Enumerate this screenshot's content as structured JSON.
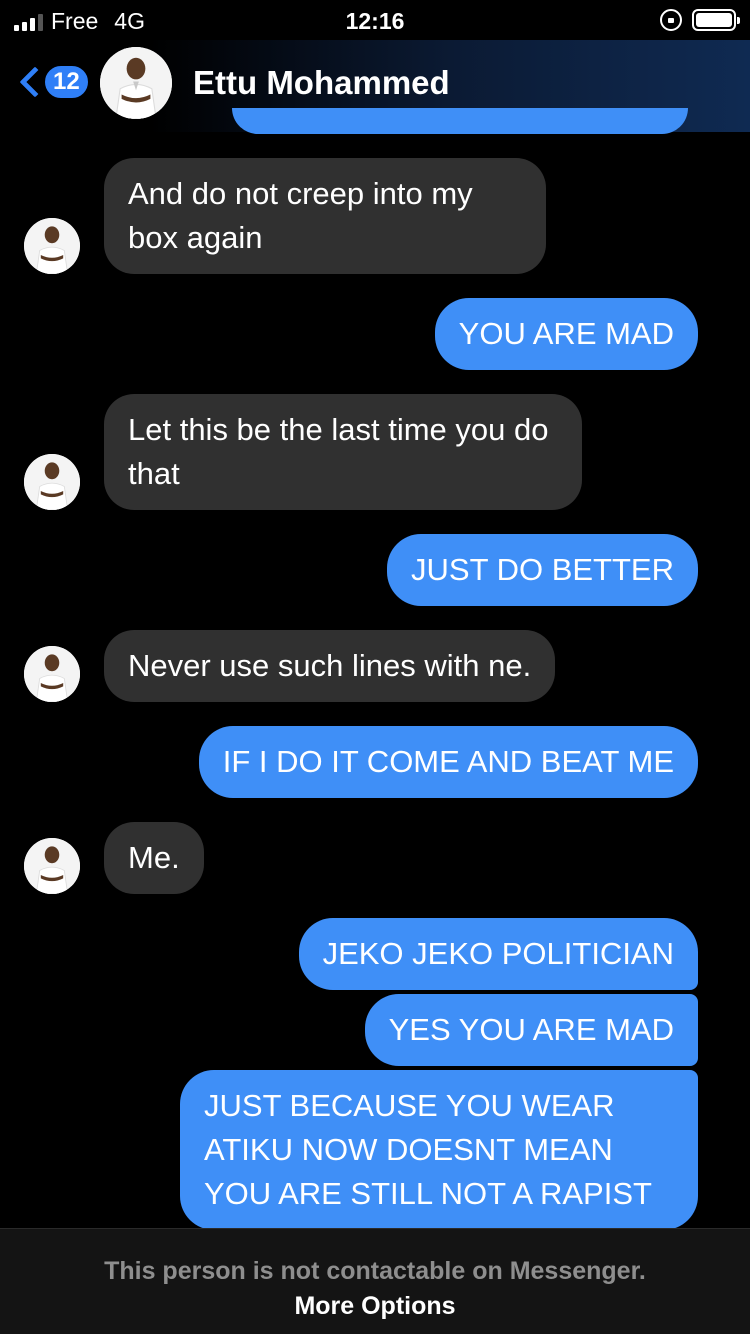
{
  "status_bar": {
    "carrier": "Free",
    "network": "4G",
    "time": "12:16"
  },
  "header": {
    "unread_count": "12",
    "contact_name": "Ettu Mohammed"
  },
  "messages": [
    {
      "direction": "incoming",
      "text": "And do not creep into my box again"
    },
    {
      "direction": "outgoing",
      "text": "YOU ARE MAD"
    },
    {
      "direction": "incoming",
      "text": "Let this be the last time you do that"
    },
    {
      "direction": "outgoing",
      "text": "JUST DO BETTER"
    },
    {
      "direction": "incoming",
      "text": "Never use such lines with ne."
    },
    {
      "direction": "outgoing",
      "text": "IF I DO IT COME AND BEAT ME"
    },
    {
      "direction": "incoming",
      "text": "Me."
    },
    {
      "direction": "outgoing",
      "text": "JEKO JEKO POLITICIAN"
    },
    {
      "direction": "outgoing",
      "text": "YES YOU ARE MAD"
    },
    {
      "direction": "outgoing",
      "text": "JUST BECAUSE YOU WEAR ATIKU NOW DOESNT MEAN YOU ARE STILL NOT A RAPIST"
    }
  ],
  "footer": {
    "note": "This person is not contactable on Messenger.",
    "link": "More Options"
  },
  "colors": {
    "accent": "#2f7ff7",
    "outgoing_bubble": "#3f8ff7",
    "incoming_bubble": "#303030",
    "background": "#000000"
  },
  "icons": [
    "signal-icon",
    "screen-rotation-lock-icon",
    "battery-icon",
    "back-chevron-icon"
  ]
}
